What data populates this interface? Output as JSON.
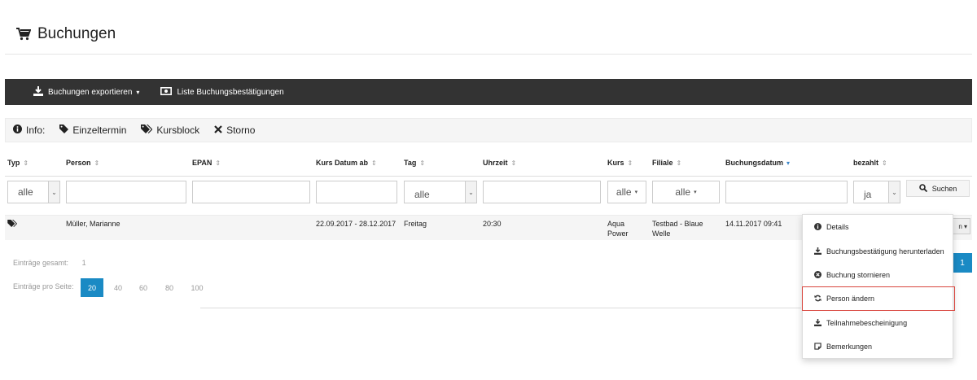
{
  "page": {
    "title": "Buchungen"
  },
  "toolbar": {
    "export_label": "Buchungen exportieren",
    "export_caret": "▾",
    "list_label": "Liste Buchungsbestätigungen"
  },
  "info": {
    "label": "Info:",
    "einzeltermin": "Einzeltermin",
    "kursblock": "Kursblock",
    "storno": "Storno"
  },
  "table": {
    "headers": {
      "typ": "Typ",
      "person": "Person",
      "epan": "EPAN",
      "kurs_datum": "Kurs Datum ab",
      "tag": "Tag",
      "uhrzeit": "Uhrzeit",
      "kurs": "Kurs",
      "filiale": "Filiale",
      "buchungsdatum": "Buchungsdatum",
      "bezahlt": "bezahlt"
    },
    "sort_neutral": "⇕",
    "sort_active": "▾",
    "filters": {
      "typ": "alle",
      "tag": "alle",
      "kurs": "alle",
      "filiale": "alle",
      "bezahlt": "ja",
      "search_label": "Suchen"
    },
    "row": {
      "person": "Müller, Marianne",
      "kurs_datum": "22.09.2017 - 28.12.2017",
      "tag": "Freitag",
      "uhrzeit": "20:30",
      "kurs_line1": "Aqua",
      "kurs_line2": "Power",
      "filiale_line1": "Testbad - Blaue",
      "filiale_line2": "Welle",
      "buchungsdatum": "14.11.2017 09:41",
      "action_partial": "n ▾"
    }
  },
  "summary": {
    "total_label": "Einträge gesamt:",
    "total_value": "1",
    "per_page_label": "Einträge pro Seite:",
    "per_page_options": [
      "20",
      "40",
      "60",
      "80",
      "100"
    ],
    "current_page": "1"
  },
  "menu": {
    "items": [
      {
        "label": "Details",
        "icon": "info-circle-icon"
      },
      {
        "label": "Buchungsbestätigung herunterladen",
        "icon": "download-icon"
      },
      {
        "label": "Buchung stornieren",
        "icon": "times-circle-icon"
      },
      {
        "label": "Person ändern",
        "icon": "refresh-icon"
      },
      {
        "label": "Teilnahmebescheinigung",
        "icon": "download-icon"
      },
      {
        "label": "Bemerkungen",
        "icon": "note-icon"
      }
    ]
  },
  "colors": {
    "toolbar_bg": "#333333",
    "primary": "#1a8ac4",
    "highlight_border": "#d9453d"
  }
}
